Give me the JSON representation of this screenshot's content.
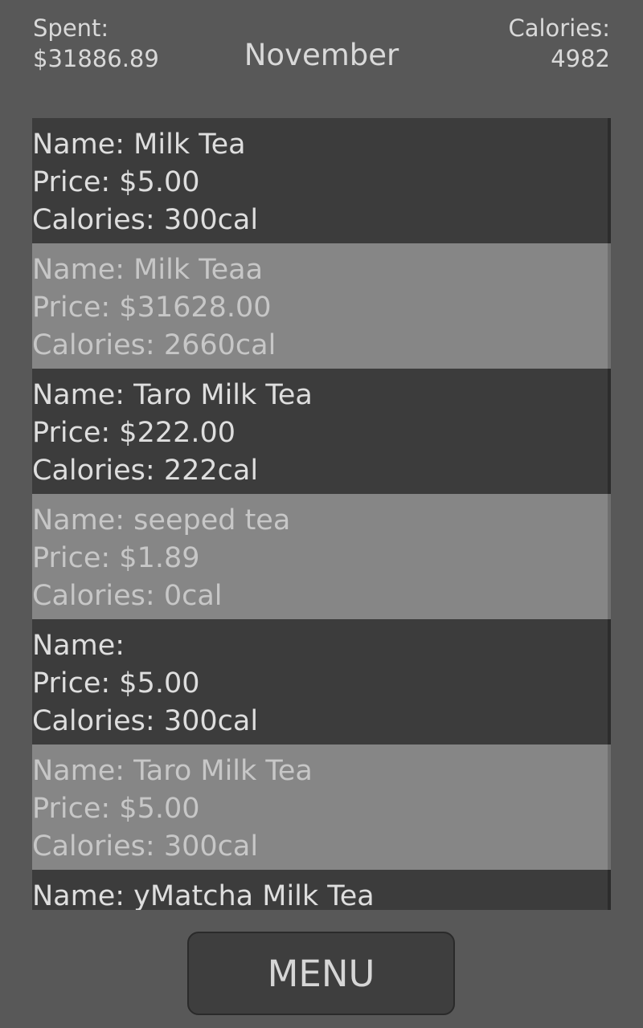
{
  "header": {
    "spent_label": "Spent:",
    "spent_value": "$31886.89",
    "month": "November",
    "calories_label": "Calories:",
    "calories_value": "4982"
  },
  "items": [
    {
      "name": "Name: Milk Tea",
      "price": "Price: $5.00",
      "calories": "Calories: 300cal"
    },
    {
      "name": "Name: Milk Teaa",
      "price": "Price: $31628.00",
      "calories": "Calories: 2660cal"
    },
    {
      "name": "Name: Taro Milk Tea",
      "price": "Price: $222.00",
      "calories": "Calories: 222cal"
    },
    {
      "name": "Name: seeped tea",
      "price": "Price: $1.89",
      "calories": "Calories: 0cal"
    },
    {
      "name": "Name:",
      "price": "Price: $5.00",
      "calories": "Calories: 300cal"
    },
    {
      "name": "Name: Taro Milk Tea",
      "price": "Price: $5.00",
      "calories": "Calories: 300cal"
    },
    {
      "name": "Name: yMatcha Milk Tea",
      "price": "",
      "calories": ""
    }
  ],
  "menu_button": {
    "label": "MENU"
  },
  "colors": {
    "background": "#585858",
    "row_dark": "#3c3c3c",
    "row_light": "#868686"
  }
}
